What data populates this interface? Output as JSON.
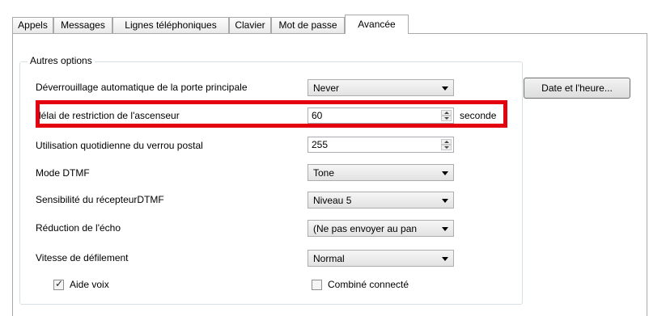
{
  "tabs": [
    {
      "label": "Appels",
      "active": false
    },
    {
      "label": "Messages",
      "active": false
    },
    {
      "label": "Lignes téléphoniques",
      "active": false
    },
    {
      "label": "Clavier",
      "active": false
    },
    {
      "label": "Mot de passe",
      "active": false
    },
    {
      "label": "Avancée",
      "active": true
    }
  ],
  "group_title": "Autres options",
  "rows": {
    "door_unlock": {
      "label": "Déverrouillage automatique de la porte principale",
      "value": "Never"
    },
    "elevator_delay": {
      "label": "délai de restriction de l'ascenseur",
      "value": "60",
      "unit": "seconde"
    },
    "postal_lock": {
      "label": "Utilisation quotidienne du verrou postal",
      "value": "255"
    },
    "dtmf_mode": {
      "label": "Mode DTMF",
      "value": "Tone"
    },
    "dtmf_sensitivity": {
      "label": "Sensibilité du récepteurDTMF",
      "value": "Niveau 5"
    },
    "echo_reduction": {
      "label": "Réduction de l'écho",
      "value": "(Ne pas envoyer au pan"
    },
    "scroll_speed": {
      "label": "Vitesse de défilement",
      "value": "Normal"
    }
  },
  "checkboxes": {
    "voice_help": {
      "label": "Aide voix",
      "checked": true
    },
    "handset": {
      "label": "Combiné connecté",
      "checked": false
    }
  },
  "date_time_button": "Date et l'heure...",
  "colors": {
    "highlight": "#e3000f",
    "border": "#a9a9a9"
  }
}
